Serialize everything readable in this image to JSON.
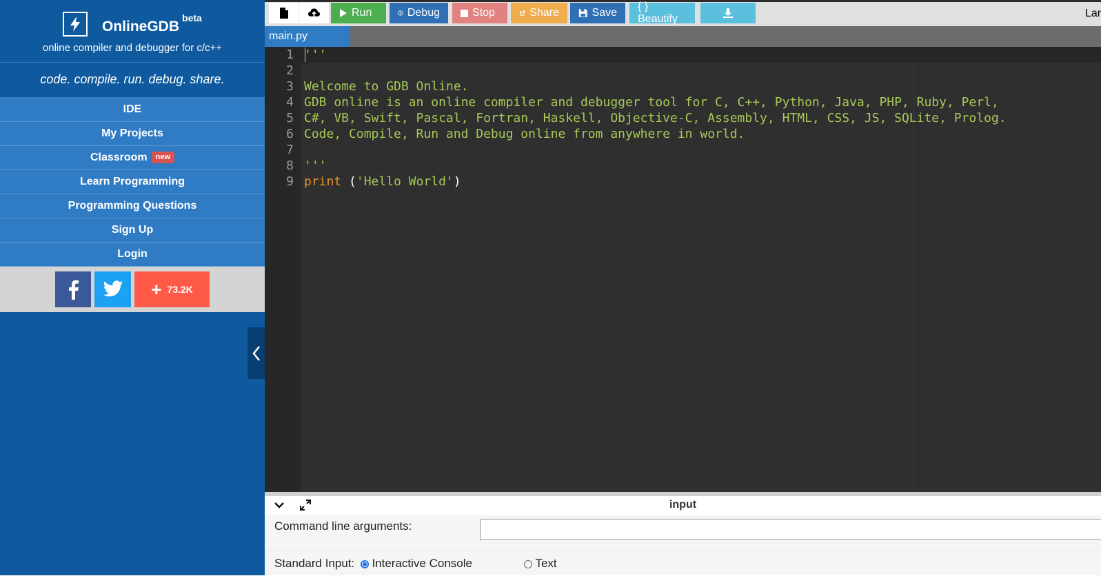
{
  "brand": {
    "name": "OnlineGDB",
    "badge": "beta",
    "subtitle": "online compiler and debugger for c/c++",
    "tagline": "code. compile. run. debug. share."
  },
  "nav": {
    "items": [
      {
        "label": "IDE"
      },
      {
        "label": "My Projects"
      },
      {
        "label": "Classroom",
        "badge": "new"
      },
      {
        "label": "Learn Programming"
      },
      {
        "label": "Programming Questions"
      },
      {
        "label": "Sign Up"
      },
      {
        "label": "Login"
      }
    ]
  },
  "social": {
    "facebook_icon": "facebook-icon",
    "twitter_icon": "twitter-icon",
    "share_count": "73.2K"
  },
  "toolbar": {
    "run": "Run",
    "debug": "Debug",
    "stop": "Stop",
    "share": "Share",
    "save": "Save",
    "beautify": "{ } Beautify",
    "language_label": "Lar"
  },
  "editor": {
    "tab": "main.py",
    "lines": [
      {
        "n": "1",
        "text": "'''"
      },
      {
        "n": "2",
        "text": ""
      },
      {
        "n": "3",
        "text": "Welcome to GDB Online."
      },
      {
        "n": "4",
        "text": "GDB online is an online compiler and debugger tool for C, C++, Python, Java, PHP, Ruby, Perl,"
      },
      {
        "n": "5",
        "text": "C#, VB, Swift, Pascal, Fortran, Haskell, Objective-C, Assembly, HTML, CSS, JS, SQLite, Prolog."
      },
      {
        "n": "6",
        "text": "Code, Compile, Run and Debug online from anywhere in world."
      },
      {
        "n": "7",
        "text": ""
      },
      {
        "n": "8",
        "text": "'''"
      },
      {
        "n": "9",
        "kw": "print",
        "rest_open": " (",
        "str": "'Hello World'",
        "rest_close": ")"
      }
    ]
  },
  "io": {
    "title": "input",
    "cmd_args_label": "Command line arguments:",
    "cmd_args_value": "",
    "stdin_label": "Standard Input:",
    "option_interactive": "Interactive Console",
    "option_text": "Text",
    "selected": "Interactive Console"
  },
  "colors": {
    "sidebar": "#0f5a9e",
    "nav": "#2f7bc4",
    "run": "#4cae4c",
    "debug": "#2f6fb6",
    "stop": "#d9534f",
    "share": "#f0ad4e",
    "save": "#2f6fb6",
    "beautify": "#5bc0de",
    "download": "#5bc0de"
  }
}
